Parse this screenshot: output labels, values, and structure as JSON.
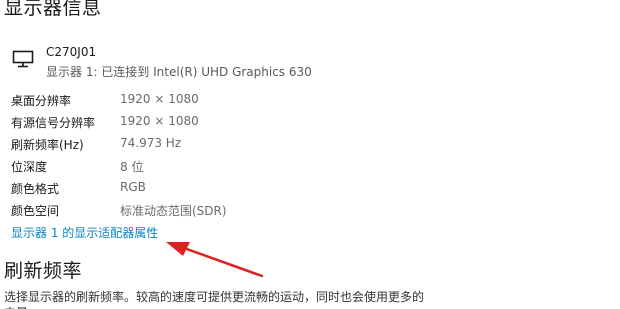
{
  "section_display_info": {
    "title": "显示器信息",
    "monitor": {
      "name": "C270J01",
      "connection": "显示器 1: 已连接到 Intel(R) UHD Graphics 630",
      "icon": "monitor-icon"
    },
    "properties": [
      {
        "label": "桌面分辨率",
        "value": "1920 × 1080"
      },
      {
        "label": "有源信号分辨率",
        "value": "1920 × 1080"
      },
      {
        "label": "刷新频率(Hz)",
        "value": "74.973 Hz"
      },
      {
        "label": "位深度",
        "value": "8 位"
      },
      {
        "label": "颜色格式",
        "value": "RGB"
      },
      {
        "label": "颜色空间",
        "value": "标准动态范围(SDR)"
      }
    ],
    "adapter_link": "显示器 1 的显示适配器属性"
  },
  "section_refresh": {
    "title": "刷新频率",
    "description": "选择显示器的刷新频率。较高的速度可提供更流畅的运动，同时也会使用更多的电量。"
  },
  "annotation": {
    "arrow_color": "#e02020"
  },
  "colors": {
    "link": "#0a84c8",
    "value_text": "#6a6a6a"
  }
}
